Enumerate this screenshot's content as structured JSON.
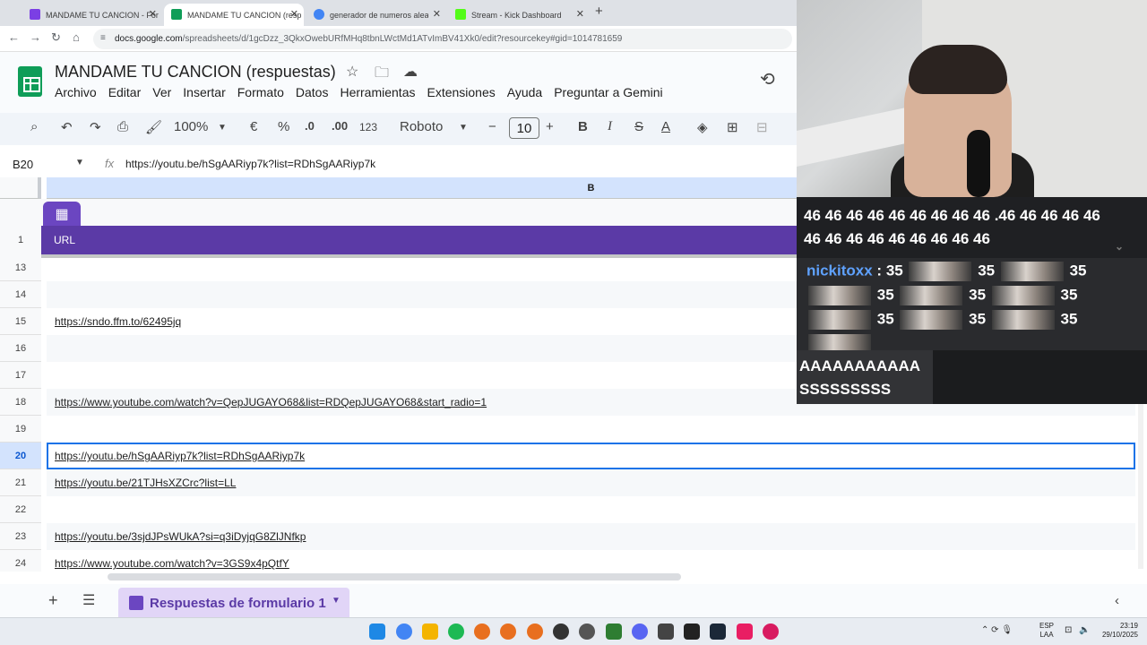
{
  "browser": {
    "tabs": [
      {
        "label": "MANDAME TU CANCION - For",
        "icon": "forms-icon",
        "color": "#7b3fe4"
      },
      {
        "label": "MANDAME TU CANCION (resp",
        "icon": "sheets-icon",
        "color": "#0f9d58"
      },
      {
        "label": "generador de numeros aleatori",
        "icon": "google-icon",
        "color": "#4285f4"
      },
      {
        "label": "Stream - Kick Dashboard",
        "icon": "kick-icon",
        "color": "#53fc18"
      }
    ],
    "url_domain": "docs.google.com",
    "url_path": "/spreadsheets/d/1gcDzz_3QkxOwebURfMHq8tbnLWctMd1ATvImBV41Xk0/edit?resourcekey#gid=1014781659"
  },
  "sheet": {
    "title": "MANDAME TU CANCION (respuestas)",
    "menus": [
      "Archivo",
      "Editar",
      "Ver",
      "Insertar",
      "Formato",
      "Datos",
      "Herramientas",
      "Extensiones",
      "Ayuda",
      "Preguntar a Gemini"
    ],
    "toolbar": {
      "zoom": "100%",
      "currency": "€",
      "percent": "%",
      "dec_less": ".0",
      "dec_more": ".00",
      "number_format": "123",
      "font": "Roboto",
      "font_size": "10",
      "bold": "B",
      "italic": "I",
      "strike": "S",
      "text_color": "A"
    },
    "cell_ref": "B20",
    "formula": "https://youtu.be/hSgAARiyp7k?list=RDhSgAARiyp7k",
    "column_header": "B",
    "header_row": {
      "num": "1",
      "value": "URL"
    },
    "rows": [
      {
        "num": "13",
        "value": ""
      },
      {
        "num": "14",
        "value": ""
      },
      {
        "num": "15",
        "value": "https://sndo.ffm.to/62495jq"
      },
      {
        "num": "16",
        "value": ""
      },
      {
        "num": "17",
        "value": ""
      },
      {
        "num": "18",
        "value": "https://www.youtube.com/watch?v=QepJUGAYO68&list=RDQepJUGAYO68&start_radio=1"
      },
      {
        "num": "19",
        "value": ""
      },
      {
        "num": "20",
        "value": "https://youtu.be/hSgAARiyp7k?list=RDhSgAARiyp7k"
      },
      {
        "num": "21",
        "value": "https://youtu.be/21TJHsXZCrc?list=LL"
      },
      {
        "num": "22",
        "value": ""
      },
      {
        "num": "23",
        "value": "https://youtu.be/3sjdJPsWUkA?si=q3iDyjqG8ZlJNfkp"
      },
      {
        "num": "24",
        "value": "https://www.youtube.com/watch?v=3GS9x4pQtfY"
      }
    ],
    "sheet_tab": "Respuestas de formulario 1"
  },
  "overlay": {
    "chat_spam_line1": "46 46 46 46 46 46 46 46 46 .46 46 46 46 46",
    "chat_spam_line2": "46 46 46 46 46 46 46 46 46",
    "chat_user": "nickitoxx",
    "chat_emote_count": "35",
    "chat_caps_1": "AAAAAAAAAAA",
    "chat_caps_2": "SSSSSSSSS"
  },
  "taskbar": {
    "lang_1": "ESP",
    "lang_2": "LAA",
    "time": "23:19",
    "date": "29/10/2025"
  },
  "accent_colors": {
    "sheets_purple": "#5b3aa6",
    "selection_blue": "#1a73e8"
  }
}
